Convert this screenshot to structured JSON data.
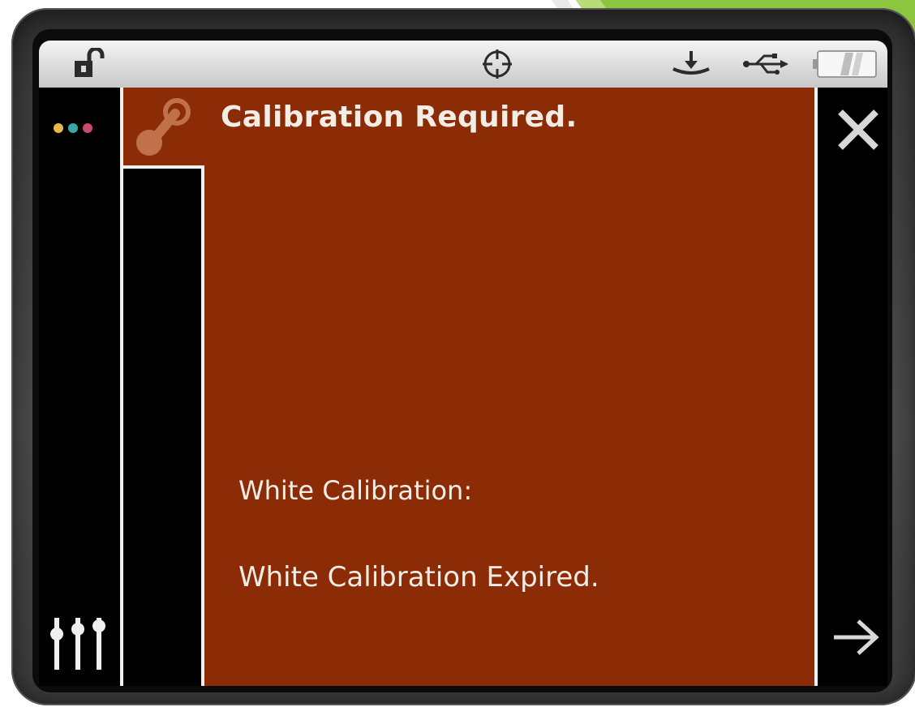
{
  "status_bar": {
    "lock_icon": "unlocked-padlock-icon",
    "target_icon": "crosshair-target-icon",
    "download_icon": "download-tray-icon",
    "usb_icon": "usb-icon",
    "battery_icon": "battery-icon"
  },
  "left_rail": {
    "dots_icon": "color-dots-icon",
    "dot_colors": [
      "#e8b84a",
      "#3aa6a6",
      "#c94a6a"
    ],
    "settings_icon": "mixer-sliders-icon"
  },
  "dialog": {
    "icon": "link-chain-icon",
    "title": "Calibration Required.",
    "label": "White Calibration:",
    "message": "White Calibration Expired."
  },
  "right_rail": {
    "close_icon": "close-icon",
    "next_icon": "arrow-right-icon"
  },
  "colors": {
    "panel": "#8b2c06",
    "text": "#f3ede6",
    "accent_green": "#7dbb2f"
  }
}
